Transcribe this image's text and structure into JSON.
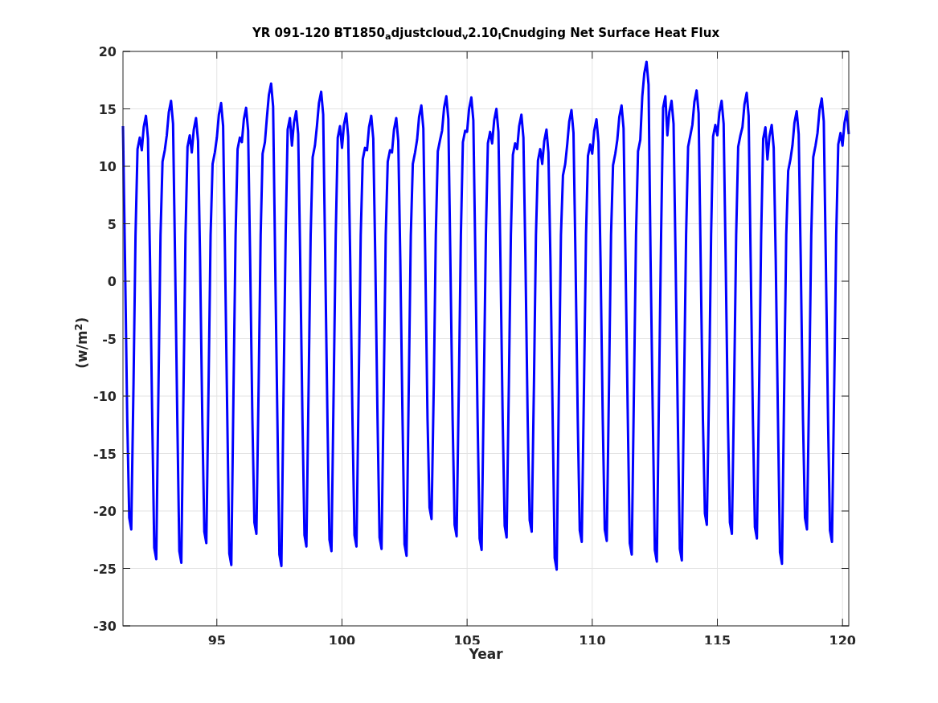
{
  "chart_data": {
    "type": "line",
    "title": "YR 091-120 BT1850$_{a}$djustcloud$_{v}$2.10$_{I}$Cnudging Net Surface Heat Flux",
    "xlabel": "Year",
    "ylabel": "(w/m$^{2}$)",
    "grid": true,
    "xlim": [
      91.25,
      120.25
    ],
    "ylim": [
      -30,
      20
    ],
    "xticks": [
      95,
      100,
      105,
      110,
      115,
      120
    ],
    "yticks": [
      -30,
      -25,
      -20,
      -15,
      -10,
      -5,
      0,
      5,
      10,
      15,
      20
    ],
    "x": [
      91.25,
      91.33,
      91.42,
      91.5,
      91.58,
      91.67,
      91.75,
      91.83,
      91.92,
      92,
      92.08,
      92.17,
      92.25,
      92.33,
      92.42,
      92.5,
      92.58,
      92.67,
      92.75,
      92.83,
      92.92,
      93,
      93.08,
      93.17,
      93.25,
      93.33,
      93.42,
      93.5,
      93.58,
      93.67,
      93.75,
      93.83,
      93.92,
      94,
      94.08,
      94.17,
      94.25,
      94.33,
      94.42,
      94.5,
      94.58,
      94.67,
      94.75,
      94.83,
      94.92,
      95,
      95.08,
      95.17,
      95.25,
      95.33,
      95.42,
      95.5,
      95.58,
      95.67,
      95.75,
      95.83,
      95.92,
      96,
      96.08,
      96.17,
      96.25,
      96.33,
      96.42,
      96.5,
      96.58,
      96.67,
      96.75,
      96.83,
      96.92,
      97,
      97.08,
      97.17,
      97.25,
      97.33,
      97.42,
      97.5,
      97.58,
      97.67,
      97.75,
      97.83,
      97.92,
      98,
      98.08,
      98.17,
      98.25,
      98.33,
      98.42,
      98.5,
      98.58,
      98.67,
      98.75,
      98.83,
      98.92,
      99,
      99.08,
      99.17,
      99.25,
      99.33,
      99.42,
      99.5,
      99.58,
      99.67,
      99.75,
      99.83,
      99.92,
      100,
      100.08,
      100.17,
      100.25,
      100.33,
      100.42,
      100.5,
      100.58,
      100.67,
      100.75,
      100.83,
      100.92,
      101,
      101.08,
      101.17,
      101.25,
      101.33,
      101.42,
      101.5,
      101.58,
      101.67,
      101.75,
      101.83,
      101.92,
      102,
      102.08,
      102.17,
      102.25,
      102.33,
      102.42,
      102.5,
      102.58,
      102.67,
      102.75,
      102.83,
      102.92,
      103,
      103.08,
      103.17,
      103.25,
      103.33,
      103.42,
      103.5,
      103.58,
      103.67,
      103.75,
      103.83,
      103.92,
      104,
      104.08,
      104.17,
      104.25,
      104.33,
      104.42,
      104.5,
      104.58,
      104.67,
      104.75,
      104.83,
      104.92,
      105,
      105.08,
      105.17,
      105.25,
      105.33,
      105.42,
      105.5,
      105.58,
      105.67,
      105.75,
      105.83,
      105.92,
      106,
      106.08,
      106.17,
      106.25,
      106.33,
      106.42,
      106.5,
      106.58,
      106.67,
      106.75,
      106.83,
      106.92,
      107,
      107.08,
      107.17,
      107.25,
      107.33,
      107.42,
      107.5,
      107.58,
      107.67,
      107.75,
      107.83,
      107.92,
      108,
      108.08,
      108.17,
      108.25,
      108.33,
      108.42,
      108.5,
      108.58,
      108.67,
      108.75,
      108.83,
      108.92,
      109,
      109.08,
      109.17,
      109.25,
      109.33,
      109.42,
      109.5,
      109.58,
      109.67,
      109.75,
      109.83,
      109.92,
      110,
      110.08,
      110.17,
      110.25,
      110.33,
      110.42,
      110.5,
      110.58,
      110.67,
      110.75,
      110.83,
      110.92,
      111,
      111.08,
      111.17,
      111.25,
      111.33,
      111.42,
      111.5,
      111.58,
      111.67,
      111.75,
      111.83,
      111.92,
      112,
      112.08,
      112.17,
      112.25,
      112.33,
      112.42,
      112.5,
      112.58,
      112.67,
      112.75,
      112.83,
      112.92,
      113,
      113.08,
      113.17,
      113.25,
      113.33,
      113.42,
      113.5,
      113.58,
      113.67,
      113.75,
      113.83,
      113.92,
      114,
      114.08,
      114.17,
      114.25,
      114.33,
      114.42,
      114.5,
      114.58,
      114.67,
      114.75,
      114.83,
      114.92,
      115,
      115.08,
      115.17,
      115.25,
      115.33,
      115.42,
      115.5,
      115.58,
      115.67,
      115.75,
      115.83,
      115.92,
      116,
      116.08,
      116.17,
      116.25,
      116.33,
      116.42,
      116.5,
      116.58,
      116.67,
      116.75,
      116.83,
      116.92,
      117,
      117.08,
      117.17,
      117.25,
      117.33,
      117.42,
      117.5,
      117.58,
      117.67,
      117.75,
      117.83,
      117.92,
      118,
      118.08,
      118.17,
      118.25,
      118.33,
      118.42,
      118.5,
      118.58,
      118.67,
      118.75,
      118.83,
      118.92,
      119,
      119.08,
      119.17,
      119.25,
      119.33,
      119.42,
      119.5,
      119.58,
      119.67,
      119.75,
      119.83,
      119.92,
      120,
      120.08,
      120.17,
      120.25
    ],
    "series": [
      {
        "color": "#0000ff",
        "values": [
          13.5,
          2,
          -12,
          -20.6,
          -21.6,
          -9,
          4,
          11.5,
          12.5,
          11.4,
          13.4,
          14.4,
          12.4,
          2,
          -12,
          -23.2,
          -24.2,
          -9,
          4,
          10.4,
          11.4,
          12.7,
          14.7,
          15.7,
          13.7,
          2,
          -12,
          -23.5,
          -24.5,
          -9,
          4,
          11.7,
          12.7,
          11.2,
          13.2,
          14.2,
          12.2,
          2,
          -12,
          -21.8,
          -22.8,
          -9,
          4,
          10.2,
          11.2,
          12.5,
          14.5,
          15.5,
          13.5,
          2,
          -12,
          -23.7,
          -24.7,
          -9,
          4,
          11.5,
          12.5,
          12.1,
          14.1,
          15.1,
          13.1,
          2,
          -12,
          -21,
          -22,
          -9,
          4,
          11.1,
          12.1,
          14.2,
          16.2,
          17.2,
          15.2,
          2,
          -12,
          -23.8,
          -24.8,
          -9,
          4,
          13.2,
          14.2,
          11.8,
          13.8,
          14.8,
          12.8,
          2,
          -12,
          -22.1,
          -23.1,
          -9,
          4,
          10.8,
          11.8,
          13.5,
          15.5,
          16.5,
          14.5,
          2,
          -12,
          -22.5,
          -23.5,
          -9,
          4,
          12.5,
          13.5,
          11.6,
          13.6,
          14.6,
          12.6,
          2,
          -12,
          -22.1,
          -23.1,
          -9,
          4,
          10.6,
          11.6,
          11.4,
          13.4,
          14.4,
          12.4,
          2,
          -12,
          -22.3,
          -23.3,
          -9,
          4,
          10.4,
          11.4,
          11.2,
          13.2,
          14.2,
          12.2,
          2,
          -12,
          -22.9,
          -23.9,
          -9,
          4,
          10.2,
          11.2,
          12.3,
          14.3,
          15.3,
          13.3,
          2,
          -12,
          -19.7,
          -20.7,
          -9,
          4,
          11.3,
          12.3,
          13.1,
          15.1,
          16.1,
          14.1,
          2,
          -12,
          -21.2,
          -22.2,
          -9,
          4,
          12.1,
          13.1,
          13,
          15,
          16,
          14,
          2,
          -12,
          -22.4,
          -23.4,
          -9,
          4,
          12,
          13,
          12,
          14,
          15,
          13,
          2,
          -12,
          -21.3,
          -22.3,
          -9,
          4,
          11,
          12,
          11.5,
          13.5,
          14.5,
          12.5,
          2,
          -12,
          -20.8,
          -21.8,
          -9,
          4,
          10.5,
          11.5,
          10.2,
          12.2,
          13.2,
          11.2,
          2,
          -12,
          -24.1,
          -25.1,
          -9,
          4,
          9.2,
          10.2,
          11.9,
          13.9,
          14.9,
          12.9,
          2,
          -12,
          -21.7,
          -22.7,
          -9,
          4,
          10.9,
          11.9,
          11.1,
          13.1,
          14.1,
          12.1,
          2,
          -12,
          -21.6,
          -22.6,
          -9,
          4,
          10.1,
          11.1,
          12.3,
          14.3,
          15.3,
          13.3,
          2,
          -12,
          -22.8,
          -23.8,
          -9,
          4,
          11.3,
          12.3,
          16.1,
          18.1,
          19.1,
          17.1,
          2,
          -12,
          -23.4,
          -24.4,
          -9,
          4,
          15.1,
          16.1,
          12.7,
          14.7,
          15.7,
          13.7,
          2,
          -12,
          -23.3,
          -24.3,
          -9,
          4,
          11.7,
          12.7,
          13.6,
          15.6,
          16.6,
          14.6,
          2,
          -12,
          -20.2,
          -21.2,
          -9,
          4,
          12.6,
          13.6,
          12.7,
          14.7,
          15.7,
          13.7,
          2,
          -12,
          -21,
          -22,
          -9,
          4,
          11.7,
          12.7,
          13.4,
          15.4,
          16.4,
          14.4,
          2,
          -12,
          -21.4,
          -22.4,
          -9,
          4,
          12.4,
          13.4,
          10.6,
          12.6,
          13.6,
          11.6,
          2,
          -12,
          -23.6,
          -24.6,
          -9,
          4,
          9.6,
          10.6,
          11.8,
          13.8,
          14.8,
          12.8,
          2,
          -12,
          -20.6,
          -21.6,
          -9,
          4,
          10.8,
          11.8,
          12.9,
          14.9,
          15.9,
          13.9,
          2,
          -12,
          -21.7,
          -22.7,
          -9,
          4,
          11.9,
          12.9,
          11.8,
          13.8,
          14.8,
          12.8
        ]
      }
    ]
  }
}
